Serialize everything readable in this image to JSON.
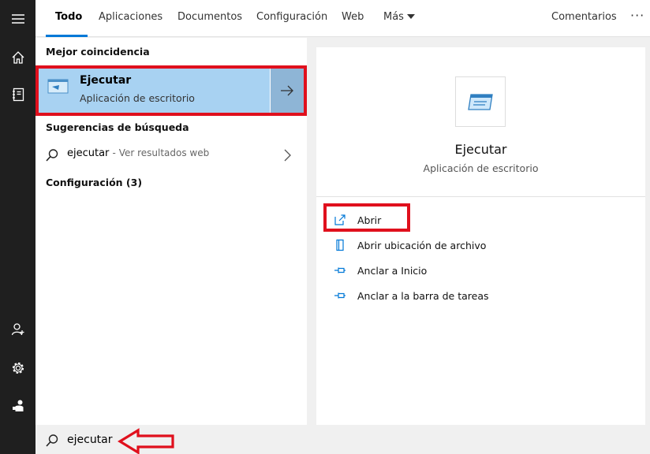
{
  "tabs": [
    {
      "label": "Todo",
      "active": true
    },
    {
      "label": "Aplicaciones"
    },
    {
      "label": "Documentos"
    },
    {
      "label": "Configuración"
    },
    {
      "label": "Web"
    },
    {
      "label": "Más"
    }
  ],
  "feedback_label": "Comentarios",
  "more_options": "···",
  "sidebar": {
    "top_icons": [
      "hamburger-menu-icon",
      "home-icon",
      "notebook-icon"
    ],
    "bottom_icons": [
      "add-user-icon",
      "gear-icon",
      "feedback-hub-icon"
    ]
  },
  "left": {
    "best_match_title": "Mejor coincidencia",
    "best_match": {
      "name": "Ejecutar",
      "type": "Aplicación de escritorio"
    },
    "suggestions_title": "Sugerencias de búsqueda",
    "suggestion": {
      "query": "ejecutar",
      "suffix": "- Ver resultados web"
    },
    "settings_title": "Configuración (3)"
  },
  "right": {
    "app_name": "Ejecutar",
    "app_type": "Aplicación de escritorio",
    "actions": [
      {
        "label": "Abrir",
        "icon": "open-icon"
      },
      {
        "label": "Abrir ubicación de archivo",
        "icon": "file-location-icon"
      },
      {
        "label": "Anclar a Inicio",
        "icon": "pin-icon"
      },
      {
        "label": "Anclar a la barra de tareas",
        "icon": "pin-icon"
      }
    ]
  },
  "search": {
    "value": "ejecutar"
  },
  "colors": {
    "accent": "#0078d7",
    "highlight": "#a8d2f2",
    "annotation_red": "#e0101d",
    "sidebar": "#1f1f1f"
  }
}
